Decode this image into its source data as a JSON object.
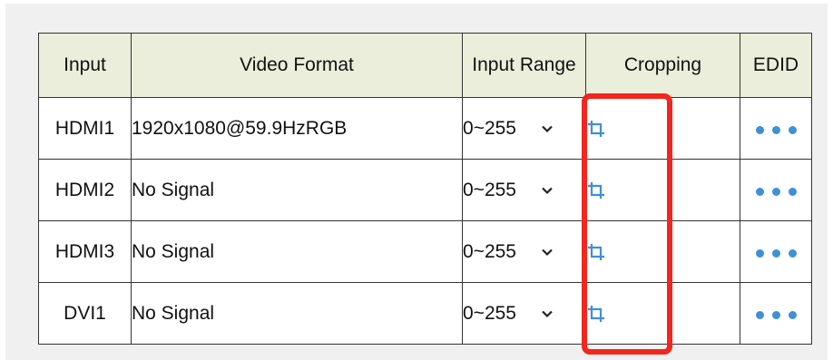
{
  "table": {
    "headers": {
      "input": "Input",
      "video_format": "Video Format",
      "input_range": "Input Range",
      "cropping": "Cropping",
      "edid": "EDID"
    },
    "rows": [
      {
        "input": "HDMI1",
        "video_format": "1920x1080@59.9HzRGB",
        "input_range": "0~255"
      },
      {
        "input": "HDMI2",
        "video_format": "No Signal",
        "input_range": "0~255"
      },
      {
        "input": "HDMI3",
        "video_format": "No Signal",
        "input_range": "0~255"
      },
      {
        "input": "DVI1",
        "video_format": "No Signal",
        "input_range": "0~255"
      }
    ]
  },
  "icons": {
    "crop": "crop-icon",
    "edid": "more-dots-icon",
    "dropdown": "chevron-down-icon"
  },
  "colors": {
    "header_bg": "#ebeeda",
    "icon_blue": "#3f90d6",
    "highlight_red": "#f2261e",
    "panel_bg": "#f0f0f0"
  }
}
